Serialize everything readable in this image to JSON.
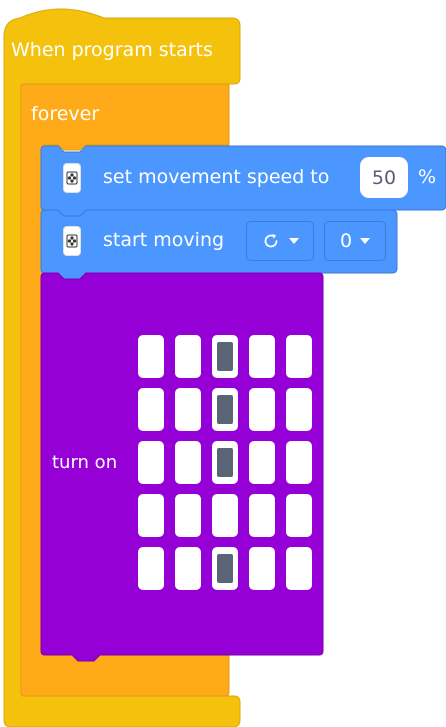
{
  "hat_block": {
    "label": "When program starts",
    "color": "#f4c20d"
  },
  "forever_block": {
    "label": "forever",
    "color": "#ffab19"
  },
  "speed_block": {
    "label": "set movement speed to",
    "value": "50",
    "unit": "%",
    "icon": "motor-controller-icon",
    "color": "#4c97ff"
  },
  "move_block": {
    "label": "start moving",
    "direction_icon": "rotate-clockwise-icon",
    "value": "0",
    "icon": "motor-controller-icon",
    "color": "#4c97ff"
  },
  "led_block": {
    "label": "turn on",
    "color": "#9500d6",
    "matrix": [
      [
        0,
        0,
        1,
        0,
        0
      ],
      [
        0,
        0,
        1,
        0,
        0
      ],
      [
        0,
        0,
        1,
        0,
        0
      ],
      [
        0,
        0,
        0,
        0,
        0
      ],
      [
        0,
        0,
        1,
        0,
        0
      ]
    ]
  }
}
